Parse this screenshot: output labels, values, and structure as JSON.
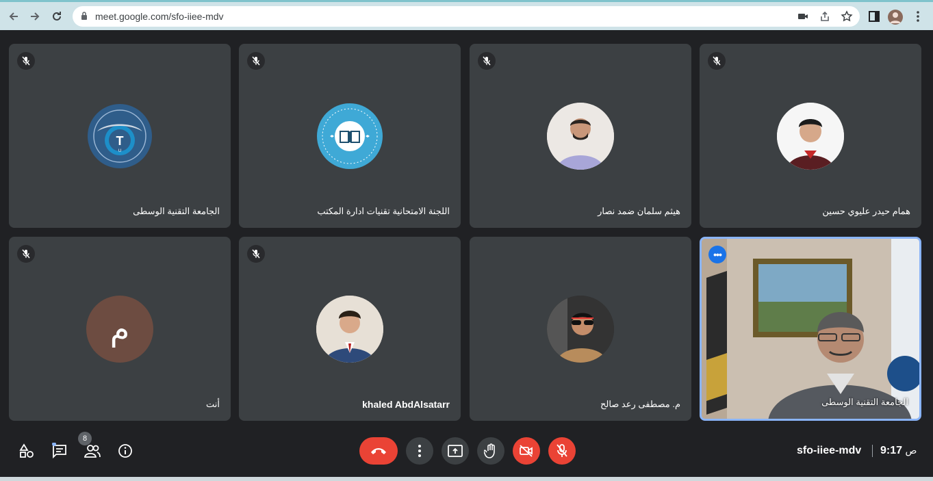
{
  "browser": {
    "url": "meet.google.com/sfo-iiee-mdv"
  },
  "tiles": [
    {
      "name": "الجامعة التقنية الوسطى",
      "avatar": "logo-middle-technical-university"
    },
    {
      "name": "اللجنة الامتحانية تقنيات ادارة المكتب",
      "avatar": "logo-office-management-dept"
    },
    {
      "name": "هيثم سلمان ضمد نصار",
      "avatar": "photo"
    },
    {
      "name": "همام حيدر عليوي حسين",
      "avatar": "photo"
    },
    {
      "name": "أنت",
      "avatar": "initial",
      "initial": "م",
      "avatar_color": "#6d4c41"
    },
    {
      "name": "khaled AbdAlsatarr",
      "avatar": "photo"
    },
    {
      "name": "م. مصطفى رعد صالح",
      "avatar": "photo"
    },
    {
      "name": "الجامعة التقنية الوسطى",
      "avatar": "video",
      "active": true
    }
  ],
  "bottom_bar": {
    "participants_count": "8",
    "meeting_code": "sfo-iiee-mdv",
    "time": "9:17",
    "time_suffix": "ص"
  },
  "colors": {
    "background": "#202124",
    "tile": "#3c4043",
    "end_call": "#ea4335",
    "active_border": "#8ab4f8",
    "accent": "#1a73e8"
  }
}
